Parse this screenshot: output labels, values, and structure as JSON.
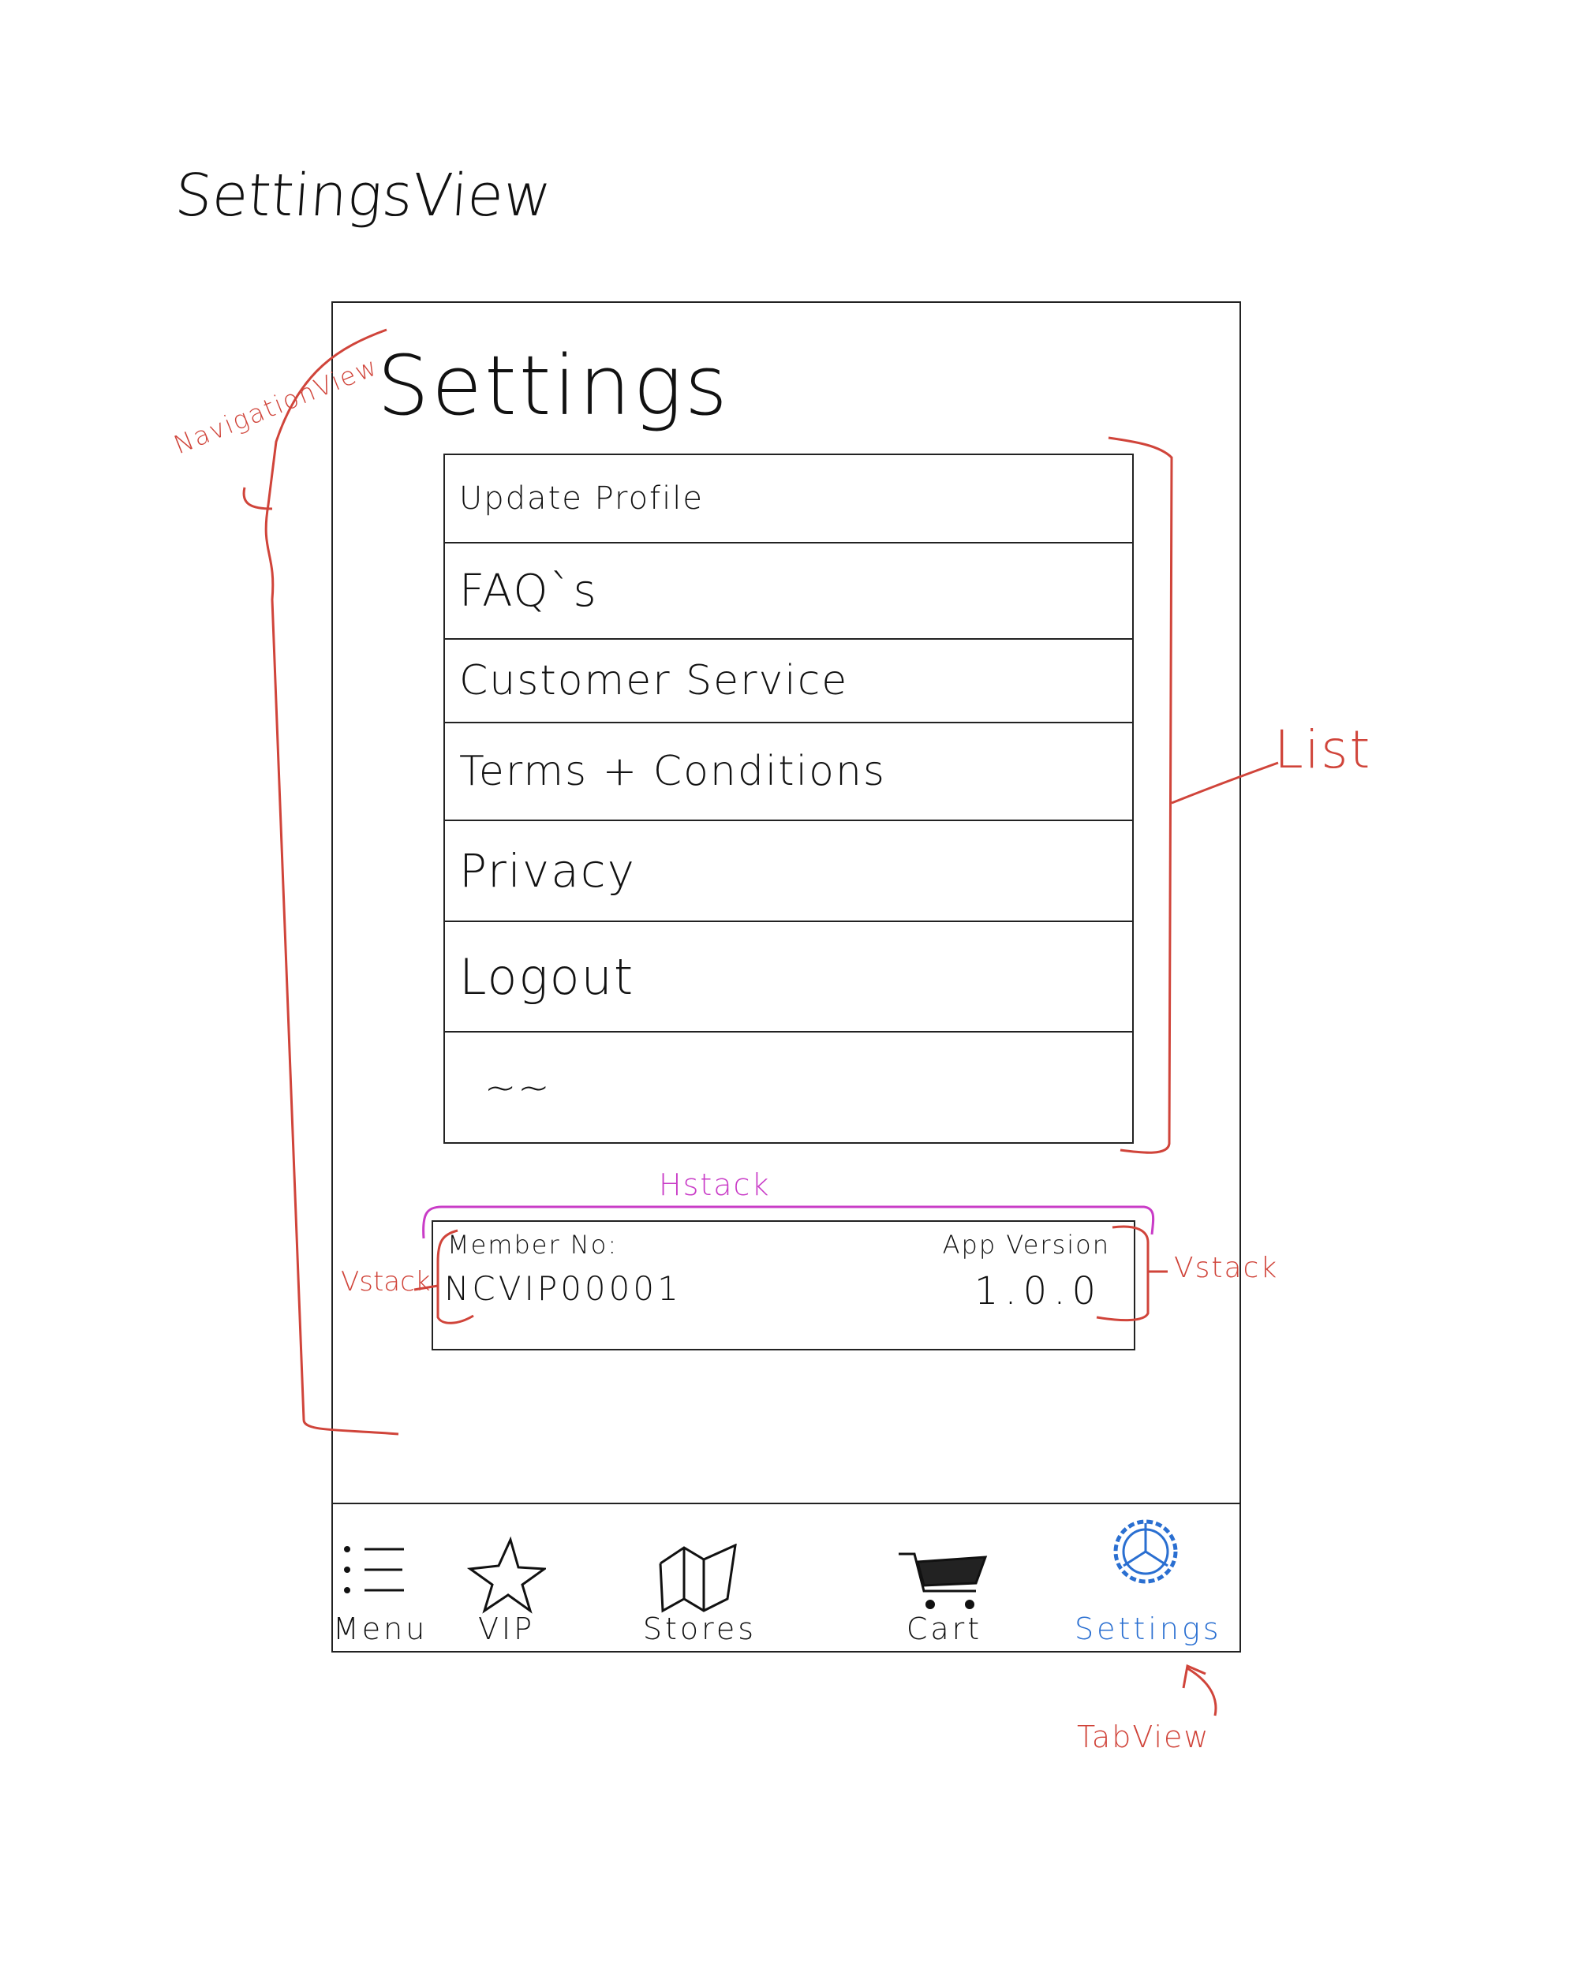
{
  "page_title": "SettingsView",
  "nav_title": "Settings",
  "list_items": [
    {
      "label": "Update Profile"
    },
    {
      "label": "FAQ`s"
    },
    {
      "label": "Customer Service"
    },
    {
      "label": "Terms + Conditions"
    },
    {
      "label": "Privacy"
    },
    {
      "label": "Logout"
    },
    {
      "label": "~~"
    }
  ],
  "info": {
    "member_label": "Member No:",
    "member_value": "NCVIP00001",
    "version_label": "App Version",
    "version_value": "1.0.0"
  },
  "tabs": [
    {
      "label": "Menu",
      "icon": "list-icon"
    },
    {
      "label": "VIP",
      "icon": "star-icon"
    },
    {
      "label": "Stores",
      "icon": "map-icon"
    },
    {
      "label": "Cart",
      "icon": "cart-icon"
    },
    {
      "label": "Settings",
      "icon": "gear-icon",
      "active": true
    }
  ],
  "annotations": {
    "navigation_view": "NavigationView",
    "list": "List",
    "hstack": "Hstack",
    "vstack_left": "Vstack",
    "vstack_right": "Vstack",
    "tab_view": "TabView"
  },
  "colors": {
    "annotation_red": "#d0443a",
    "annotation_magenta": "#c93cc7",
    "active_tab_blue": "#2a6fd1",
    "ink": "#111111"
  }
}
